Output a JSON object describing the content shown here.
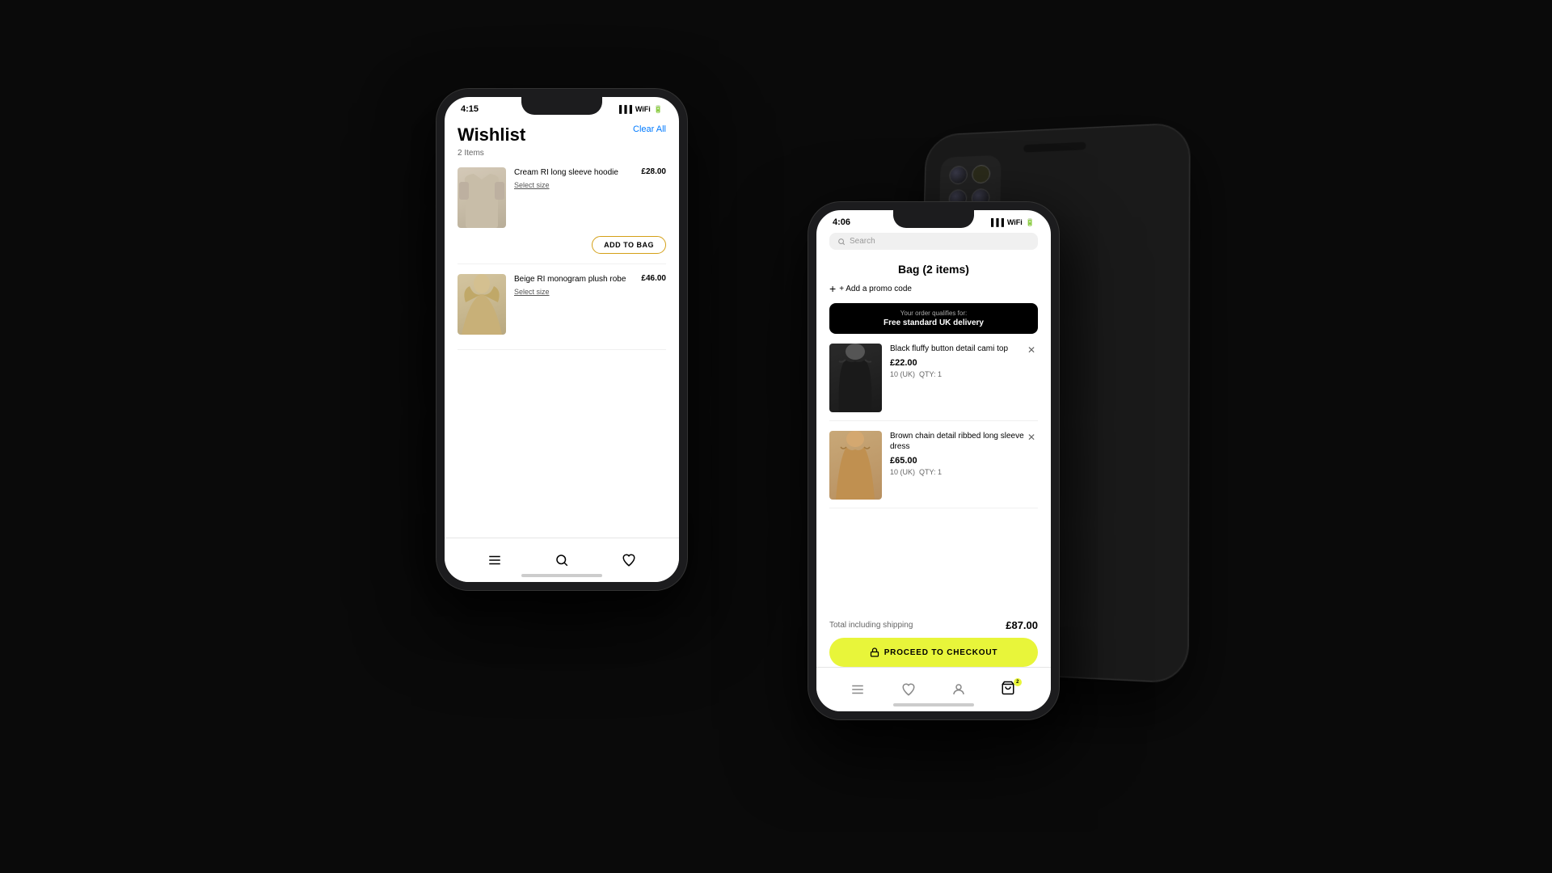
{
  "scene": {
    "background": "#0a0a0a"
  },
  "wishlist_phone": {
    "status_bar": {
      "time": "4:15",
      "icons": "●●●"
    },
    "screen": {
      "title": "Wishlist",
      "clear_all": "Clear All",
      "items_count": "2 Items",
      "items": [
        {
          "id": "item-1",
          "name": "Cream RI long sleeve hoodie",
          "price": "£28.00",
          "size_label": "Select size",
          "add_to_bag_label": "ADD TO BAG",
          "image_type": "hoodie"
        },
        {
          "id": "item-2",
          "name": "Beige RI monogram plush robe",
          "price": "£46.00",
          "size_label": "Select size",
          "image_type": "robe"
        }
      ]
    },
    "nav": {
      "items": [
        "menu",
        "search",
        "wishlist"
      ]
    }
  },
  "bag_phone": {
    "status_bar": {
      "time": "4:06",
      "icons": "●●●"
    },
    "screen": {
      "search_placeholder": "Search",
      "title": "Bag (2 items)",
      "promo_code_label": "+ Add a promo code",
      "delivery_qualifies": "Your order qualifies for:",
      "delivery_text": "Free standard UK delivery",
      "items": [
        {
          "id": "bag-item-1",
          "name": "Black fluffy button detail cami top",
          "price": "£22.00",
          "size": "10 (UK)",
          "qty": "QTY: 1",
          "image_type": "cami"
        },
        {
          "id": "bag-item-2",
          "name": "Brown chain detail ribbed long sleeve dress",
          "price": "£65.00",
          "size": "10 (UK)",
          "qty": "QTY: 1",
          "image_type": "dress"
        }
      ],
      "total_label": "Total including shipping",
      "total_amount": "£87.00",
      "checkout_label": "PROCEED TO CHECKOUT"
    },
    "nav": {
      "items": [
        "menu",
        "wishlist",
        "account",
        "bag"
      ],
      "bag_badge": "2"
    }
  }
}
